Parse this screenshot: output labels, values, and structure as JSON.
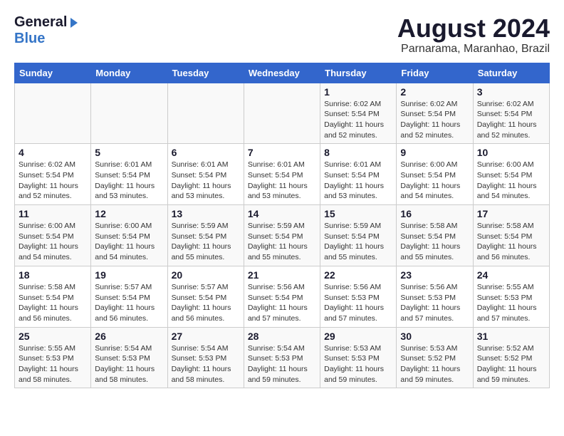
{
  "header": {
    "logo_general": "General",
    "logo_blue": "Blue",
    "month_year": "August 2024",
    "location": "Parnarama, Maranhao, Brazil"
  },
  "days_of_week": [
    "Sunday",
    "Monday",
    "Tuesday",
    "Wednesday",
    "Thursday",
    "Friday",
    "Saturday"
  ],
  "weeks": [
    [
      {
        "day": "",
        "info": ""
      },
      {
        "day": "",
        "info": ""
      },
      {
        "day": "",
        "info": ""
      },
      {
        "day": "",
        "info": ""
      },
      {
        "day": "1",
        "info": "Sunrise: 6:02 AM\nSunset: 5:54 PM\nDaylight: 11 hours and 52 minutes."
      },
      {
        "day": "2",
        "info": "Sunrise: 6:02 AM\nSunset: 5:54 PM\nDaylight: 11 hours and 52 minutes."
      },
      {
        "day": "3",
        "info": "Sunrise: 6:02 AM\nSunset: 5:54 PM\nDaylight: 11 hours and 52 minutes."
      }
    ],
    [
      {
        "day": "4",
        "info": "Sunrise: 6:02 AM\nSunset: 5:54 PM\nDaylight: 11 hours and 52 minutes."
      },
      {
        "day": "5",
        "info": "Sunrise: 6:01 AM\nSunset: 5:54 PM\nDaylight: 11 hours and 53 minutes."
      },
      {
        "day": "6",
        "info": "Sunrise: 6:01 AM\nSunset: 5:54 PM\nDaylight: 11 hours and 53 minutes."
      },
      {
        "day": "7",
        "info": "Sunrise: 6:01 AM\nSunset: 5:54 PM\nDaylight: 11 hours and 53 minutes."
      },
      {
        "day": "8",
        "info": "Sunrise: 6:01 AM\nSunset: 5:54 PM\nDaylight: 11 hours and 53 minutes."
      },
      {
        "day": "9",
        "info": "Sunrise: 6:00 AM\nSunset: 5:54 PM\nDaylight: 11 hours and 54 minutes."
      },
      {
        "day": "10",
        "info": "Sunrise: 6:00 AM\nSunset: 5:54 PM\nDaylight: 11 hours and 54 minutes."
      }
    ],
    [
      {
        "day": "11",
        "info": "Sunrise: 6:00 AM\nSunset: 5:54 PM\nDaylight: 11 hours and 54 minutes."
      },
      {
        "day": "12",
        "info": "Sunrise: 6:00 AM\nSunset: 5:54 PM\nDaylight: 11 hours and 54 minutes."
      },
      {
        "day": "13",
        "info": "Sunrise: 5:59 AM\nSunset: 5:54 PM\nDaylight: 11 hours and 55 minutes."
      },
      {
        "day": "14",
        "info": "Sunrise: 5:59 AM\nSunset: 5:54 PM\nDaylight: 11 hours and 55 minutes."
      },
      {
        "day": "15",
        "info": "Sunrise: 5:59 AM\nSunset: 5:54 PM\nDaylight: 11 hours and 55 minutes."
      },
      {
        "day": "16",
        "info": "Sunrise: 5:58 AM\nSunset: 5:54 PM\nDaylight: 11 hours and 55 minutes."
      },
      {
        "day": "17",
        "info": "Sunrise: 5:58 AM\nSunset: 5:54 PM\nDaylight: 11 hours and 56 minutes."
      }
    ],
    [
      {
        "day": "18",
        "info": "Sunrise: 5:58 AM\nSunset: 5:54 PM\nDaylight: 11 hours and 56 minutes."
      },
      {
        "day": "19",
        "info": "Sunrise: 5:57 AM\nSunset: 5:54 PM\nDaylight: 11 hours and 56 minutes."
      },
      {
        "day": "20",
        "info": "Sunrise: 5:57 AM\nSunset: 5:54 PM\nDaylight: 11 hours and 56 minutes."
      },
      {
        "day": "21",
        "info": "Sunrise: 5:56 AM\nSunset: 5:54 PM\nDaylight: 11 hours and 57 minutes."
      },
      {
        "day": "22",
        "info": "Sunrise: 5:56 AM\nSunset: 5:53 PM\nDaylight: 11 hours and 57 minutes."
      },
      {
        "day": "23",
        "info": "Sunrise: 5:56 AM\nSunset: 5:53 PM\nDaylight: 11 hours and 57 minutes."
      },
      {
        "day": "24",
        "info": "Sunrise: 5:55 AM\nSunset: 5:53 PM\nDaylight: 11 hours and 57 minutes."
      }
    ],
    [
      {
        "day": "25",
        "info": "Sunrise: 5:55 AM\nSunset: 5:53 PM\nDaylight: 11 hours and 58 minutes."
      },
      {
        "day": "26",
        "info": "Sunrise: 5:54 AM\nSunset: 5:53 PM\nDaylight: 11 hours and 58 minutes."
      },
      {
        "day": "27",
        "info": "Sunrise: 5:54 AM\nSunset: 5:53 PM\nDaylight: 11 hours and 58 minutes."
      },
      {
        "day": "28",
        "info": "Sunrise: 5:54 AM\nSunset: 5:53 PM\nDaylight: 11 hours and 59 minutes."
      },
      {
        "day": "29",
        "info": "Sunrise: 5:53 AM\nSunset: 5:53 PM\nDaylight: 11 hours and 59 minutes."
      },
      {
        "day": "30",
        "info": "Sunrise: 5:53 AM\nSunset: 5:52 PM\nDaylight: 11 hours and 59 minutes."
      },
      {
        "day": "31",
        "info": "Sunrise: 5:52 AM\nSunset: 5:52 PM\nDaylight: 11 hours and 59 minutes."
      }
    ]
  ]
}
